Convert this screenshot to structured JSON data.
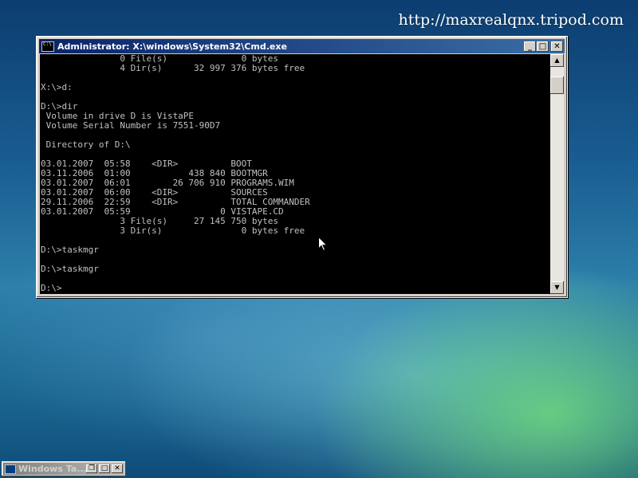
{
  "watermark": "http://maxrealqnx.tripod.com",
  "console_window": {
    "title": "Administrator: X:\\windows\\System32\\Cmd.exe",
    "buttons": {
      "minimize": "_",
      "maximize": "□",
      "close": "✕"
    },
    "lines": [
      "               0 File(s)              0 bytes",
      "               4 Dir(s)      32 997 376 bytes free",
      "",
      "X:\\>d:",
      "",
      "D:\\>dir",
      " Volume in drive D is VistaPE",
      " Volume Serial Number is 7551-90D7",
      "",
      " Directory of D:\\",
      "",
      "03.01.2007  05:58    <DIR>          BOOT",
      "03.11.2006  01:00           438 840 BOOTMGR",
      "03.01.2007  06:01        26 706 910 PROGRAMS.WIM",
      "03.01.2007  06:00    <DIR>          SOURCES",
      "29.11.2006  22:59    <DIR>          TOTAL COMMANDER",
      "03.01.2007  05:59                 0 VISTAPE.CD",
      "               3 File(s)     27 145 750 bytes",
      "               3 Dir(s)               0 bytes free",
      "",
      "D:\\>taskmgr",
      "",
      "D:\\>taskmgr",
      "",
      "D:\\>"
    ],
    "scroll": {
      "up": "▲",
      "down": "▼"
    }
  },
  "minimized_window": {
    "title": "Windows Ta...",
    "buttons": {
      "restore": "❐",
      "maximize": "□",
      "close": "✕"
    }
  },
  "icons": {
    "console": "cmd-icon",
    "task_manager": "taskmgr-icon",
    "cursor": "arrow-cursor"
  }
}
